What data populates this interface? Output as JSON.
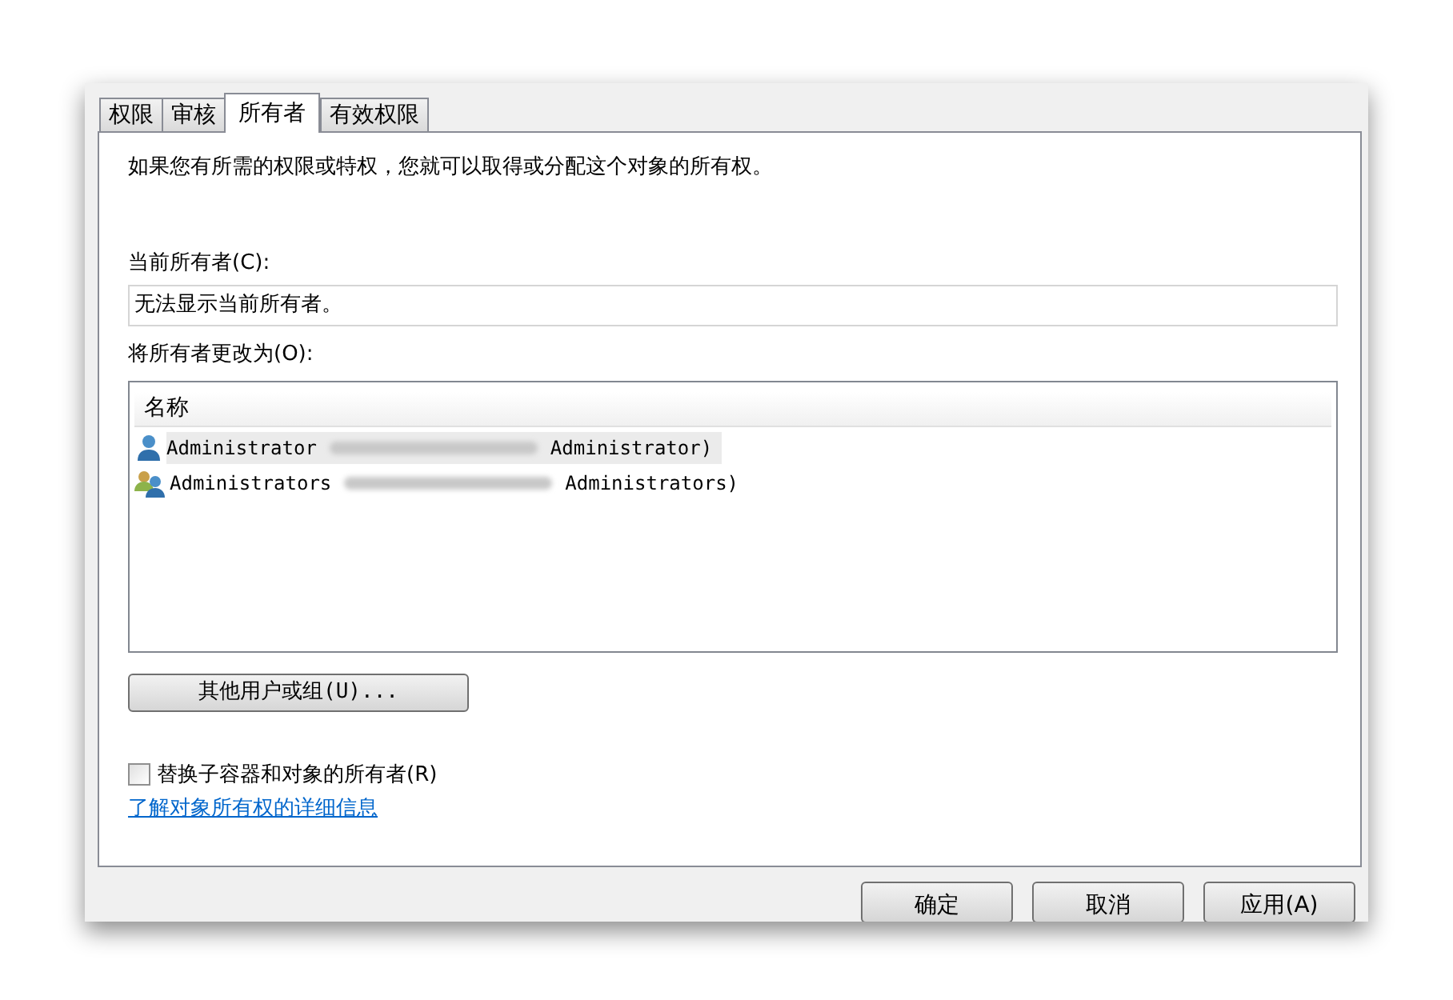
{
  "tabs": [
    {
      "label": "权限",
      "selected": false
    },
    {
      "label": "审核",
      "selected": false
    },
    {
      "label": "所有者",
      "selected": true
    },
    {
      "label": "有效权限",
      "selected": false
    }
  ],
  "intro": "如果您有所需的权限或特权，您就可以取得或分配这个对象的所有权。",
  "current_owner": {
    "label": "当前所有者(C):",
    "value": "无法显示当前所有者。"
  },
  "change_owner": {
    "label": "将所有者更改为(O):",
    "column": "名称",
    "rows": [
      {
        "kind": "user",
        "name": "Administrator",
        "suffix": "Administrator)",
        "selected": true
      },
      {
        "kind": "group",
        "name": "Administrators",
        "suffix": "Administrators)",
        "selected": false
      }
    ]
  },
  "other_button": "其他用户或组(U)...",
  "replace_checkbox": {
    "label": "替换子容器和对象的所有者(R)",
    "checked": false
  },
  "link": "了解对象所有权的详细信息",
  "buttons": [
    "确定",
    "取消",
    "应用(A)"
  ]
}
